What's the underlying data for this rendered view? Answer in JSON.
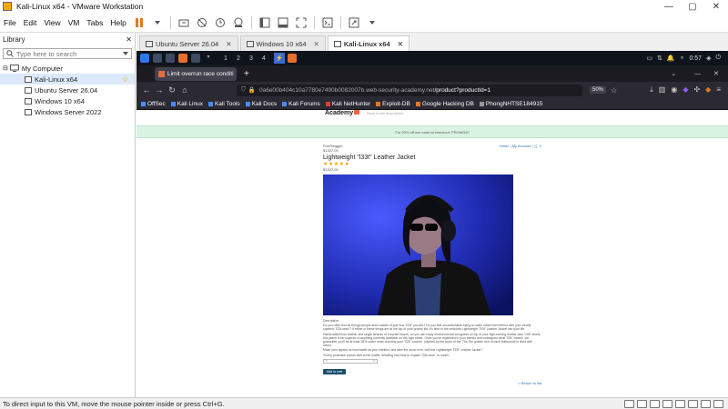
{
  "window": {
    "title": "Kali-Linux x64 - VMware Workstation",
    "min": "—",
    "max": "▢",
    "close": "✕"
  },
  "menubar": {
    "items": [
      "File",
      "Edit",
      "View",
      "VM",
      "Tabs",
      "Help"
    ]
  },
  "library": {
    "header": "Library",
    "close": "✕",
    "search_placeholder": "Type here to search",
    "root": "My Computer",
    "vms": [
      "Kali-Linux x64",
      "Ubuntu Server 26.04",
      "Windows 10 x64",
      "Windows Server 2022"
    ]
  },
  "vm_tabs": [
    {
      "label": "Ubuntu Server 26.04",
      "close": "✕"
    },
    {
      "label": "Windows 10 x64",
      "close": "✕"
    },
    {
      "label": "Kali-Linux x64",
      "close": "✕"
    }
  ],
  "kali_panel": {
    "workspaces": [
      "1",
      "2",
      "3",
      "4"
    ],
    "clock": "0:57"
  },
  "browser": {
    "tab_title": "Limit overrun race conditi",
    "tab_close": "✕",
    "new_tab": "+",
    "url_host": "0a6e00b404c10a7780e7490b0082007b.web-security-academy.net",
    "url_path": "/product?productId=1",
    "zoom": "50%",
    "bookmarks": [
      "OffSec",
      "Kali Linux",
      "Kali Tools",
      "Kali Docs",
      "Kali Forums",
      "Kali NetHunter",
      "Exploit-DB",
      "Google Hacking DB",
      "PhongNHTSE184915"
    ]
  },
  "page": {
    "logo": "Academy",
    "tagline": "Back to lab description",
    "notice": "For 20% off use code at checkout: PROMO20",
    "brand_small": "PortSwigger",
    "price_label": "$1337.00",
    "title": "Lightweight \"l33t\" Leather Jacket",
    "stars": "★★★★★",
    "price": "$1337.00",
    "nav_links": "Home | My Account | ",
    "description_heading": "Description:",
    "description": [
      "Do you often feel as though people aren't aware of just how \"l33t\" you are? Do you feel uncomfortable trying to make others feel inferior with your clearly superior \"l33t-ness\"? If either of these things are at the top of your priority list, it's time to the welcome Lightweight \"l33t\" Leather Jacket into your life.",
      "Handcrafted from leather and single strands of recycled bitcoin, so you can enjoy environmental smugness on top of your high-ranking leather-clad \"l33t\" levels, this jacket is far superior to anything currently available on the high street. Once you've explained to your friends and colleagues what \"l33t\" means, we guarantee you'll be at least 18% cooler when donning your \"l33t\" couture. Inspired by the icons of the '70s, the golden trim of each buttonhole is lined with luxury.",
      "Make your appeal as formidable as your intellect, and take the world over, with the Lightweight \"l33t\" Leather Jacket.*",
      "*Every purchase comes with a free leaflet, detailing how best to explain \"l33t-ness\" to noobs."
    ],
    "qty_minus": "<",
    "qty_plus": ">",
    "add_to_cart": "Add to cart",
    "return_link": "< Return to list"
  },
  "statusbar": {
    "message": "To direct input to this VM, move the mouse pointer inside or press Ctrl+G."
  },
  "colors": {
    "kali_panel_bg": "#0f131c",
    "firefox_bg": "#2b2a33",
    "notice_bg": "#d9f3e3",
    "button_bg": "#1c4e6e",
    "accent_star": "#f0a500"
  }
}
